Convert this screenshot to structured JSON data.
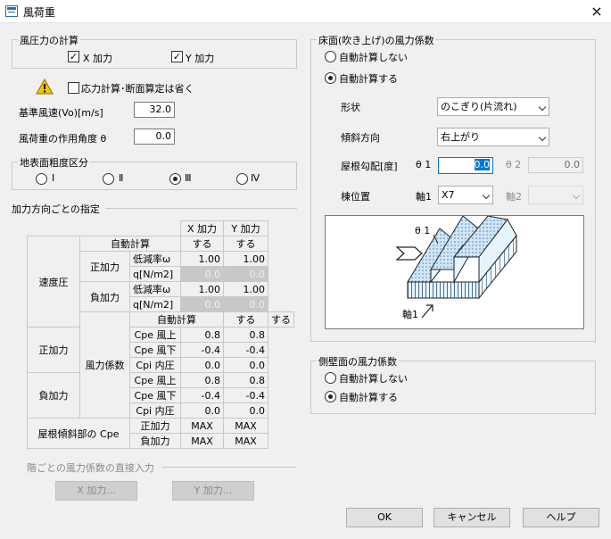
{
  "window": {
    "title": "風荷重",
    "close_icon": "×"
  },
  "wind_pressure_calc": {
    "legend": "風圧力の計算",
    "x_label": "X 加力",
    "x_checked": true,
    "y_label": "Y 加力",
    "y_checked": true
  },
  "warning_icon": "warning-icon",
  "omit_stress_label": "応力計算･断面算定は省く",
  "base_wind_speed": {
    "label": "基準風速(Vo)[m/s]",
    "value": "32.0"
  },
  "wind_angle": {
    "label": "風荷重の作用角度 θ",
    "value": "0.0"
  },
  "roughness": {
    "legend": "地表面粗度区分",
    "options": [
      "Ⅰ",
      "Ⅱ",
      "Ⅲ",
      "Ⅳ"
    ],
    "selected": "Ⅲ"
  },
  "direction_section": {
    "title": "加力方向ごとの指定",
    "headers": [
      "X 加力",
      "Y 加力"
    ],
    "velocity_pressure": "速度圧",
    "auto_calc": "自動計算",
    "positive": "正加力",
    "negative": "負加力",
    "reduction": "低減率ω",
    "q_unit": "q[N/m2]",
    "wind_coeff": "風力係数",
    "cpe_windward": "Cpe 風上",
    "cpe_leeward": "Cpe 風下",
    "cpi_internal": "Cpi 内圧",
    "roof_slope_cpe": "屋根傾斜部の Cpe",
    "vp_auto": [
      "する",
      "する"
    ],
    "vp_pos_reduction": [
      "1.00",
      "1.00"
    ],
    "vp_pos_q": [
      "0.0",
      "0.0"
    ],
    "vp_neg_reduction": [
      "1.00",
      "1.00"
    ],
    "vp_neg_q": [
      "0.0",
      "0.0"
    ],
    "wc_auto": [
      "する",
      "する"
    ],
    "wc_pos_up": [
      "0.8",
      "0.8"
    ],
    "wc_pos_down": [
      "-0.4",
      "-0.4"
    ],
    "wc_pos_cpi": [
      "0.0",
      "0.0"
    ],
    "wc_neg_up": [
      "0.8",
      "0.8"
    ],
    "wc_neg_down": [
      "-0.4",
      "-0.4"
    ],
    "wc_neg_cpi": [
      "0.0",
      "0.0"
    ],
    "roof_pos": [
      "MAX",
      "MAX"
    ],
    "roof_neg": [
      "MAX",
      "MAX"
    ]
  },
  "floor_direct": {
    "title": "階ごとの風力係数の直接入力",
    "x_button": "X 加力...",
    "y_button": "Y 加力..."
  },
  "floor_uplift": {
    "legend": "床面(吹き上げ)の風力係数",
    "no_auto": "自動計算しない",
    "auto": "自動計算する",
    "selected": "auto",
    "shape_label": "形状",
    "shape_value": "のこぎり(片流れ)",
    "slope_dir_label": "傾斜方向",
    "slope_dir_value": "右上がり",
    "roof_slope_label": "屋根勾配[度]",
    "theta1_label": "θ 1",
    "theta1_value": "0.0",
    "theta2_label": "θ 2",
    "theta2_value": "0.0",
    "ridge_label": "棟位置",
    "axis1_label": "軸1",
    "axis1_value": "X7",
    "axis2_label": "軸2",
    "axis2_value": "",
    "diagram_theta": "θ 1",
    "diagram_axis": "軸1"
  },
  "side_wall": {
    "legend": "側壁面の風力係数",
    "no_auto": "自動計算しない",
    "auto": "自動計算する",
    "selected": "auto"
  },
  "buttons": {
    "ok": "OK",
    "cancel": "キャンセル",
    "help": "ヘルプ"
  }
}
